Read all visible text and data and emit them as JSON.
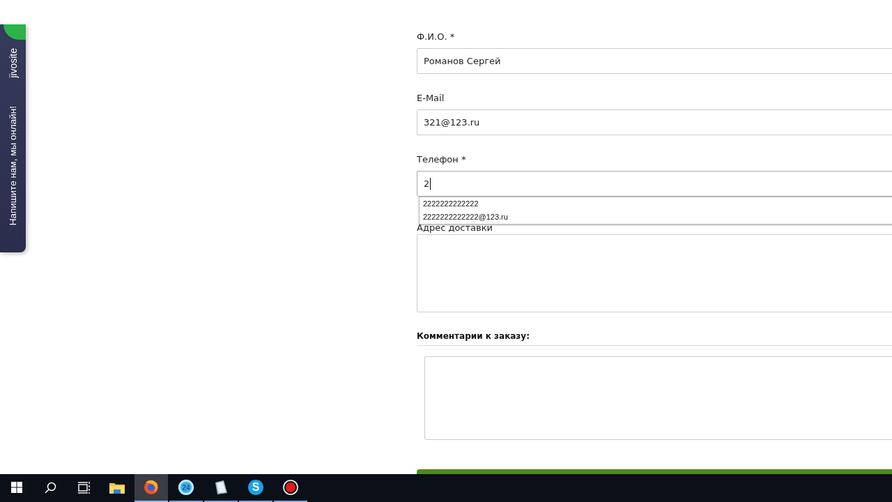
{
  "chat_widget": {
    "brand": "jivosite",
    "prompt": "Напишите нам, мы онлайн!"
  },
  "form": {
    "fields": [
      {
        "kind": "input",
        "label": "Ф.И.О. *",
        "value": "Романов Сергей",
        "focused": false
      },
      {
        "kind": "input",
        "label": "E-Mail",
        "value": "321@123.ru",
        "focused": false
      },
      {
        "kind": "input",
        "label": "Телефон *",
        "value": "2",
        "focused": true,
        "suggestions": [
          "2222222222222",
          "2222222222222@123.ru"
        ]
      },
      {
        "kind": "textarea",
        "label": "Адрес доставки"
      }
    ],
    "comments": {
      "heading": "Комментарии к заказу:"
    }
  },
  "taskbar": {
    "items": [
      {
        "kind": "start",
        "running": false,
        "selected": false
      },
      {
        "kind": "search",
        "running": false,
        "selected": false
      },
      {
        "kind": "taskview",
        "running": false,
        "selected": false
      },
      {
        "kind": "folder",
        "running": false,
        "selected": false
      },
      {
        "kind": "browser",
        "running": true,
        "selected": true
      },
      {
        "kind": "badge",
        "glyph": "24",
        "running": true,
        "selected": false
      },
      {
        "kind": "notepad",
        "running": true,
        "selected": false
      },
      {
        "kind": "chat",
        "glyph": "S",
        "running": true,
        "selected": false
      },
      {
        "kind": "record",
        "running": true,
        "selected": false
      }
    ]
  }
}
